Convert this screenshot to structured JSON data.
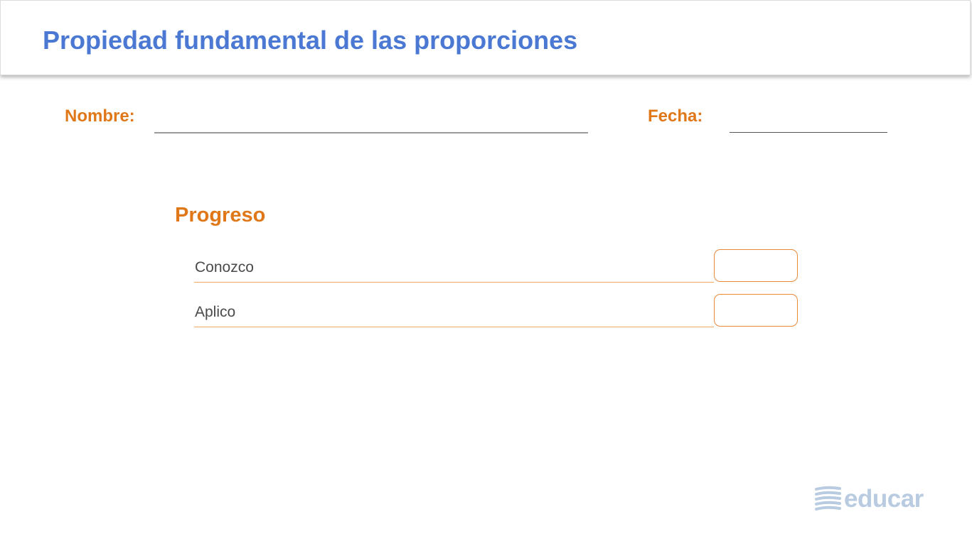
{
  "header": {
    "title": "Propiedad fundamental de las proporciones"
  },
  "form": {
    "name_label": "Nombre:",
    "date_label": "Fecha:"
  },
  "progress": {
    "title": "Progreso",
    "items": [
      {
        "label": "Conozco"
      },
      {
        "label": "Aplico"
      }
    ]
  },
  "brand": {
    "logo_text": "educar",
    "icon": "educar-logo-icon"
  },
  "colors": {
    "title_blue": "#4a78d2",
    "accent_orange": "#e07819",
    "logo_blue": "#b8cbe1"
  }
}
